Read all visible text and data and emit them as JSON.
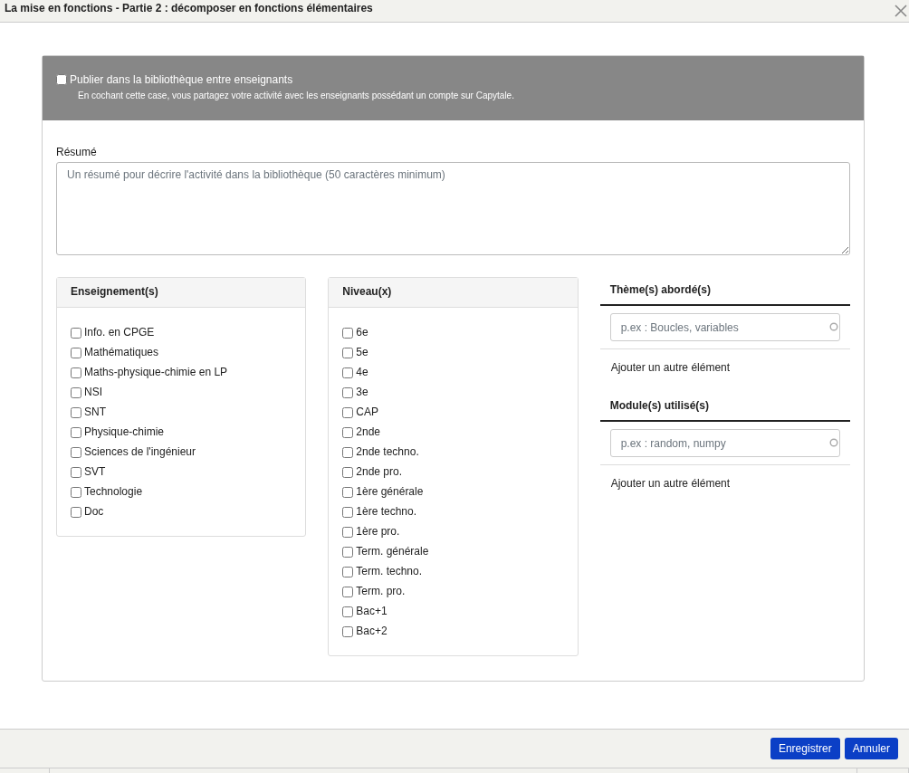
{
  "window": {
    "title": "La mise en fonctions - Partie 2 : décomposer en fonctions élémentaires"
  },
  "publish": {
    "label": "Publier dans la bibliothèque entre enseignants",
    "checked": false,
    "help": "En cochant cette case, vous partagez votre activité avec les enseignants possédant un compte sur Capytale."
  },
  "summary": {
    "label": "Résumé",
    "placeholder": "Un résumé pour décrire l'activité dans la bibliothèque (50 caractères minimum)"
  },
  "lists": [
    {
      "title": "Enseignement(s)",
      "items": [
        {
          "label": "Info. en CPGE",
          "checked": false
        },
        {
          "label": "Mathématiques",
          "checked": false
        },
        {
          "label": "Maths-physique-chimie en LP",
          "checked": false
        },
        {
          "label": "NSI",
          "checked": false
        },
        {
          "label": "SNT",
          "checked": false
        },
        {
          "label": "Physique-chimie",
          "checked": false
        },
        {
          "label": "Sciences de l'ingénieur",
          "checked": false
        },
        {
          "label": "SVT",
          "checked": false
        },
        {
          "label": "Technologie",
          "checked": false
        },
        {
          "label": "Doc",
          "checked": false
        }
      ]
    },
    {
      "title": "Niveau(x)",
      "items": [
        {
          "label": "6e",
          "checked": false
        },
        {
          "label": "5e",
          "checked": false
        },
        {
          "label": "4e",
          "checked": false
        },
        {
          "label": "3e",
          "checked": false
        },
        {
          "label": "CAP",
          "checked": false
        },
        {
          "label": "2nde",
          "checked": false
        },
        {
          "label": "2nde techno.",
          "checked": false
        },
        {
          "label": "2nde pro.",
          "checked": false
        },
        {
          "label": "1ère générale",
          "checked": false
        },
        {
          "label": "1ère techno.",
          "checked": false
        },
        {
          "label": "1ère pro.",
          "checked": false
        },
        {
          "label": "Term. générale",
          "checked": false
        },
        {
          "label": "Term. techno.",
          "checked": false
        },
        {
          "label": "Term. pro.",
          "checked": false
        },
        {
          "label": "Bac+1",
          "checked": false
        },
        {
          "label": "Bac+2",
          "checked": false
        }
      ]
    }
  ],
  "tag_fields": [
    {
      "title": "Thème(s) abordé(s)",
      "placeholder": "p.ex : Boucles, variables",
      "add_link": "Ajouter un autre élément"
    },
    {
      "title": "Module(s) utilisé(s)",
      "placeholder": "p.ex : random, numpy",
      "add_link": "Ajouter un autre élément"
    }
  ],
  "buttons": [
    "Enregistrer",
    "Annuler"
  ]
}
